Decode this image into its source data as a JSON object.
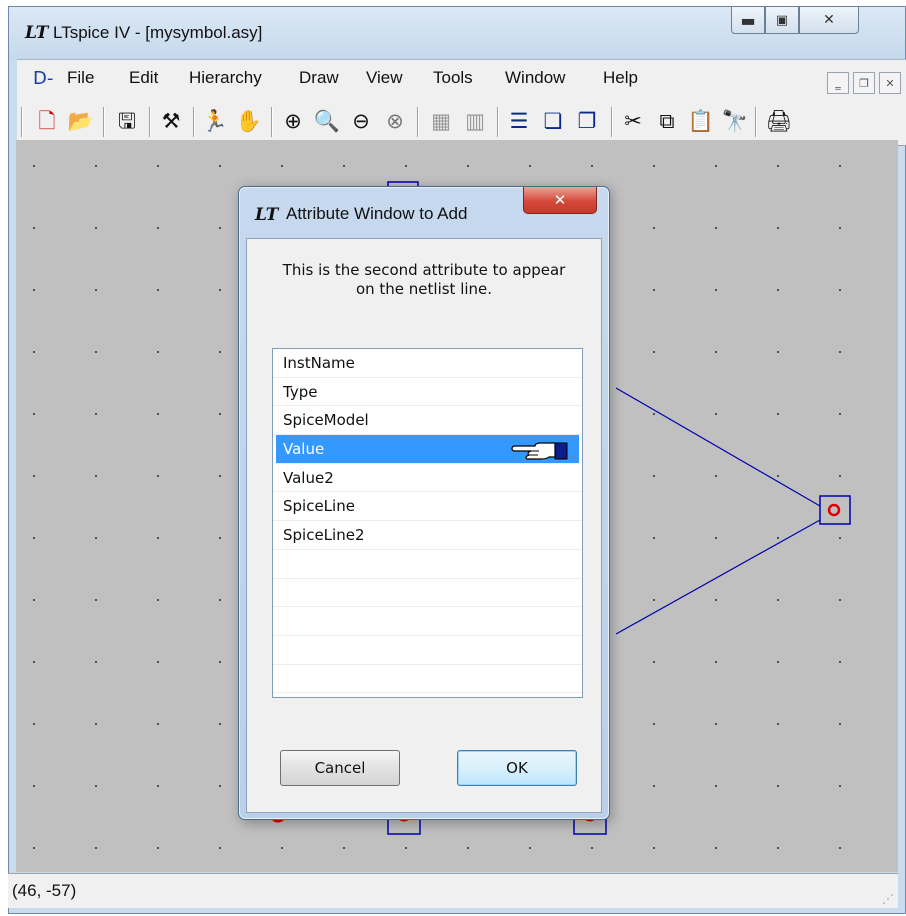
{
  "window": {
    "title": "LTspice IV - [mysymbol.asy]",
    "logo": "LT",
    "minimize_icon": "minimize-icon",
    "maximize_icon": "maximize-icon",
    "close_icon": "close-icon"
  },
  "menu": {
    "logo": "D-",
    "items": [
      "File",
      "Edit",
      "Hierarchy",
      "Draw",
      "View",
      "Tools",
      "Window",
      "Help"
    ]
  },
  "toolbar": {
    "icons": [
      "new-schematic-icon",
      "open-icon",
      "save-icon",
      "control-panel-icon",
      "run-icon",
      "halt-icon",
      "zoom-in-icon",
      "pan-icon",
      "zoom-out-icon",
      "zoom-fit-icon",
      "autorange-icon",
      "autorange-full-icon",
      "tile-horizontal-icon",
      "cascade-icon",
      "tile-vertical-icon",
      "cut-icon",
      "copy-icon",
      "paste-icon",
      "find-icon",
      "print-icon"
    ]
  },
  "status": {
    "coords": "(46, -57)"
  },
  "dialog": {
    "logo": "LT",
    "title": "Attribute Window to Add",
    "message_line1": "This is the second attribute to appear",
    "message_line2": "on the netlist line.",
    "list_items": [
      "InstName",
      "Type",
      "SpiceModel",
      "Value",
      "Value2",
      "SpiceLine",
      "SpiceLine2"
    ],
    "selected_item": "Value",
    "empty_rows": 5,
    "cancel_label": "Cancel",
    "ok_label": "OK"
  },
  "colors": {
    "selection": "#3399ff",
    "canvas": "#c0c0c0",
    "symbol_wire": "#0000b0",
    "pin": "#e00000"
  }
}
